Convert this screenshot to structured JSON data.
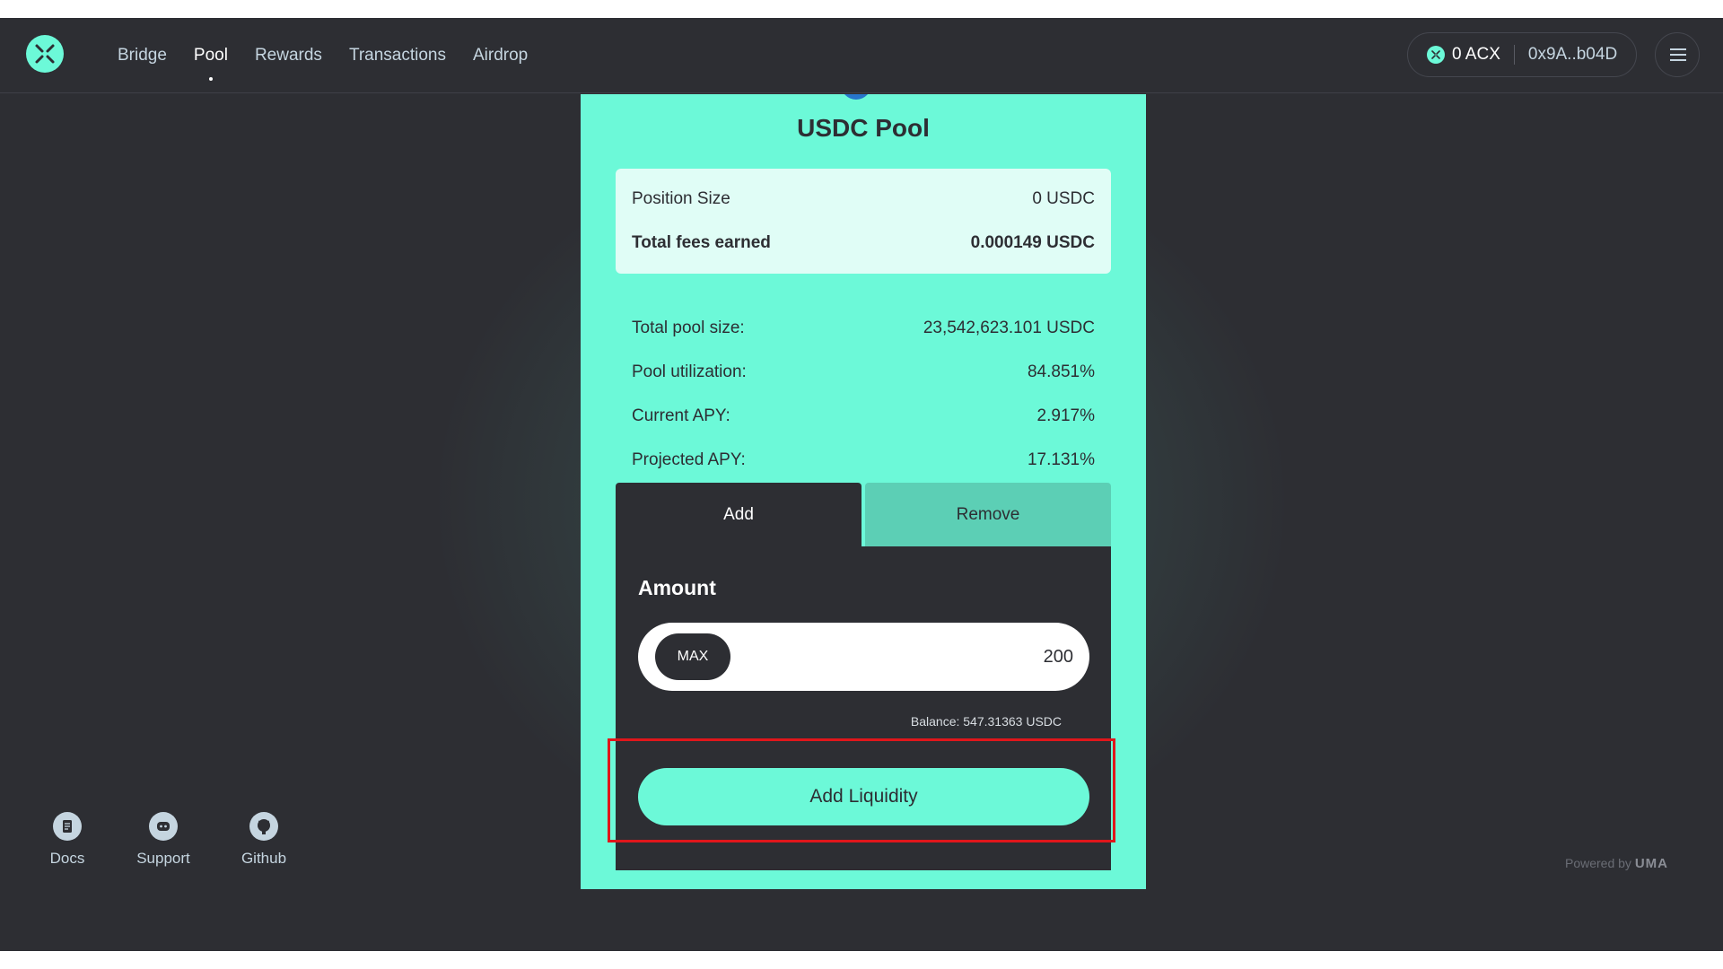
{
  "nav": {
    "items": [
      {
        "label": "Bridge"
      },
      {
        "label": "Pool"
      },
      {
        "label": "Rewards"
      },
      {
        "label": "Transactions"
      },
      {
        "label": "Airdrop"
      }
    ],
    "active": "Pool"
  },
  "wallet": {
    "acx_balance": "0 ACX",
    "address": "0x9A..b04D",
    "acx_icon": "acx-logo-icon"
  },
  "pool": {
    "title": "USDC Pool",
    "logo_icon": "usdc-logo-icon",
    "position": {
      "size_label": "Position Size",
      "size_value": "0 USDC",
      "fees_label": "Total fees earned",
      "fees_value": "0.000149 USDC"
    },
    "stats": [
      {
        "label": "Total pool size:",
        "value": "23,542,623.101 USDC"
      },
      {
        "label": "Pool utilization:",
        "value": "84.851%"
      },
      {
        "label": "Current APY:",
        "value": "2.917%"
      },
      {
        "label": "Projected APY:",
        "value": "17.131%"
      }
    ]
  },
  "tabs": {
    "add_label": "Add",
    "remove_label": "Remove",
    "active": "Add"
  },
  "form": {
    "amount_label": "Amount",
    "max_label": "MAX",
    "amount_value": "200",
    "balance": "Balance: 547.31363 USDC",
    "submit_label": "Add Liquidity"
  },
  "footer": {
    "links": [
      {
        "label": "Docs",
        "icon": "docs-icon"
      },
      {
        "label": "Support",
        "icon": "discord-icon"
      },
      {
        "label": "Github",
        "icon": "github-icon"
      }
    ],
    "powered_by": "Powered by",
    "brand": "UMA"
  },
  "colors": {
    "accent": "#6cf9d8",
    "background": "#2d2e33",
    "highlight": "#e0161b"
  }
}
